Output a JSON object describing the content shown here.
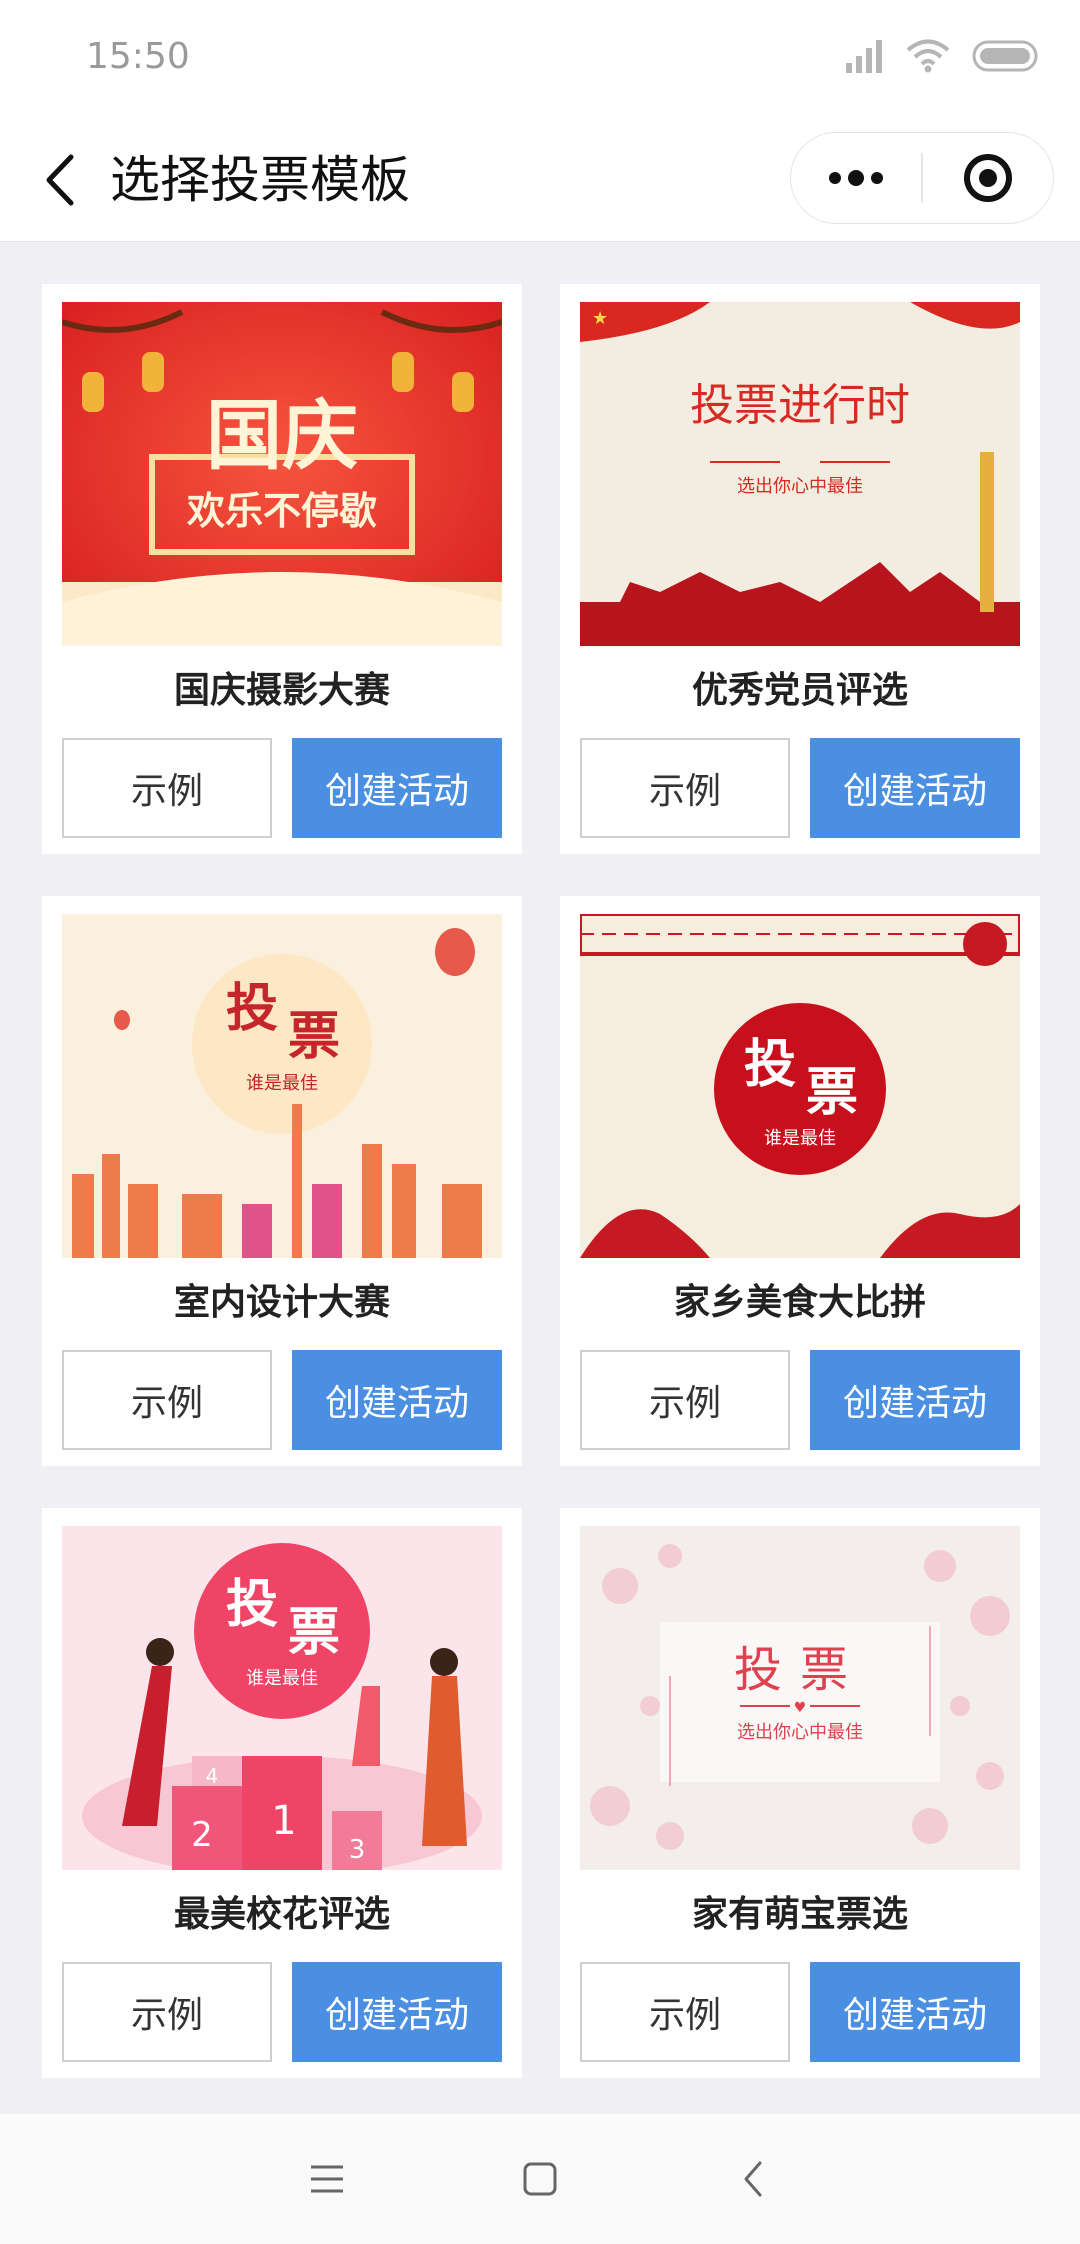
{
  "status_bar": {
    "time": "15:50"
  },
  "nav": {
    "title": "选择投票模板"
  },
  "cards": [
    {
      "title": "国庆摄影大赛",
      "example_label": "示例",
      "create_label": "创建活动",
      "image": {
        "line1": "国庆",
        "line2": "欢乐不停歇"
      }
    },
    {
      "title": "优秀党员评选",
      "example_label": "示例",
      "create_label": "创建活动",
      "image": {
        "line1": "投票进行时",
        "line2": "选出你心中最佳"
      }
    },
    {
      "title": "室内设计大赛",
      "example_label": "示例",
      "create_label": "创建活动",
      "image": {
        "line1": "投",
        "line1b": "票",
        "line2": "谁是最佳"
      }
    },
    {
      "title": "家乡美食大比拼",
      "example_label": "示例",
      "create_label": "创建活动",
      "image": {
        "line1": "投",
        "line1b": "票",
        "line2": "谁是最佳"
      }
    },
    {
      "title": "最美校花评选",
      "example_label": "示例",
      "create_label": "创建活动",
      "image": {
        "line1": "投",
        "line1b": "票",
        "line2": "谁是最佳",
        "p1": "1",
        "p2": "2",
        "p3": "3",
        "p4": "4"
      }
    },
    {
      "title": "家有萌宝票选",
      "example_label": "示例",
      "create_label": "创建活动",
      "image": {
        "line1": "投",
        "line1b": "票",
        "line2": "选出你心中最佳"
      }
    }
  ]
}
